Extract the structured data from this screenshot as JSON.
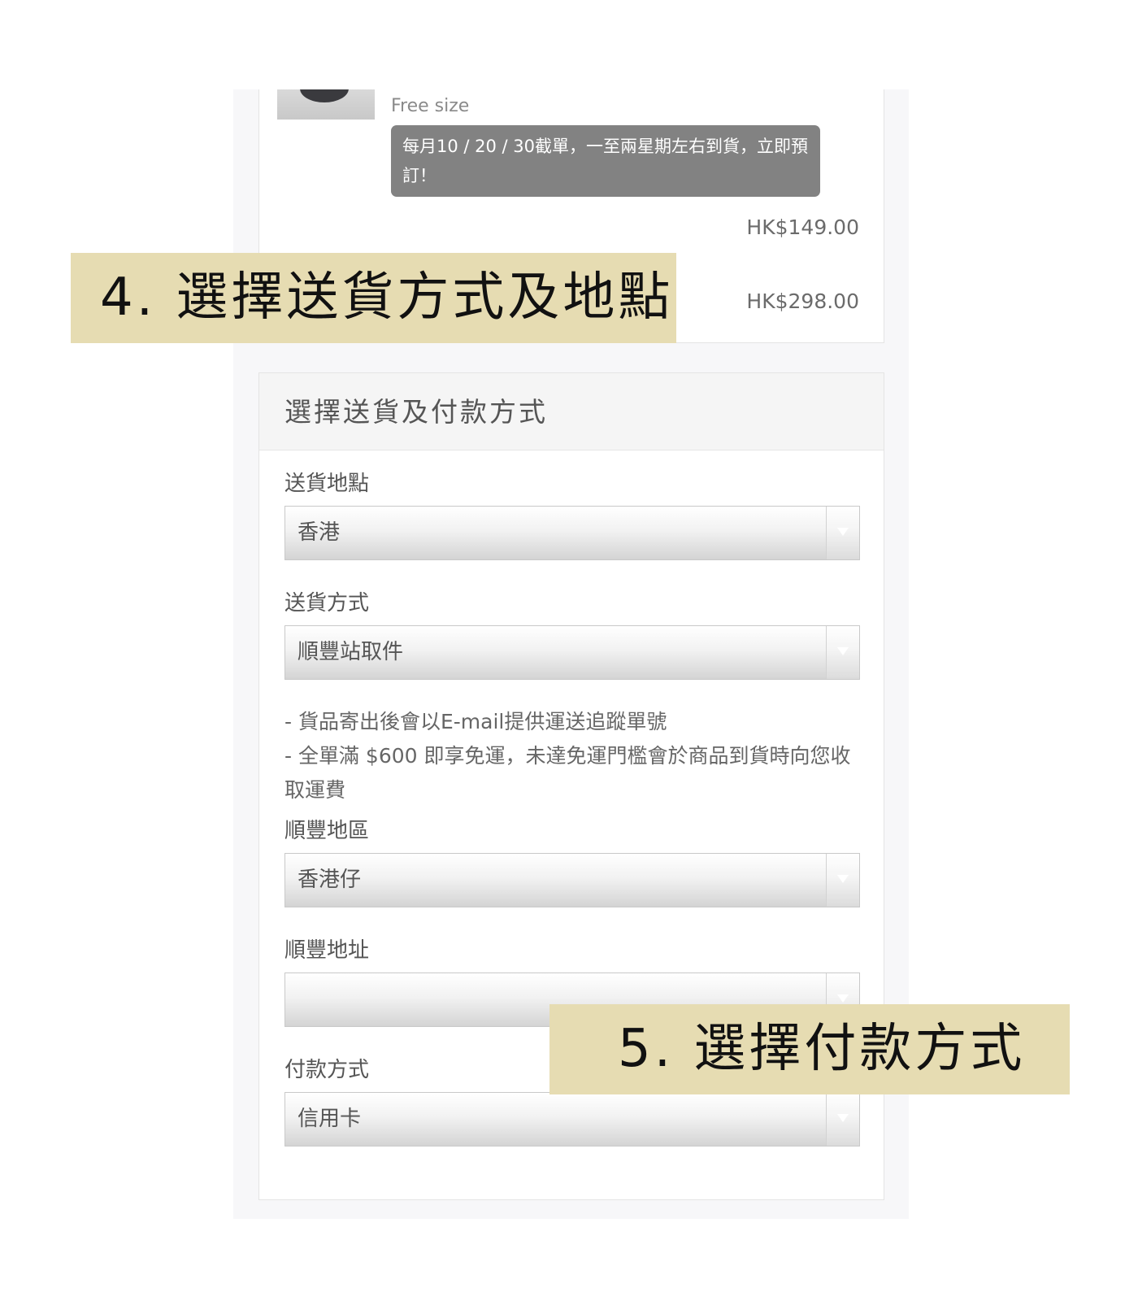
{
  "order": {
    "product_size": "Free size",
    "preorder_note": "每月10 / 20 / 30截單，一至兩星期左右到貨，立即預訂！",
    "item_price": "HK$149.00",
    "total_price": "HK$298.00"
  },
  "shipping": {
    "header": "選擇送貨及付款方式",
    "location_label": "送貨地點",
    "location_value": "香港",
    "method_label": "送貨方式",
    "method_value": "順豐站取件",
    "notes": [
      "- 貨品寄出後會以E-mail提供運送追蹤單號",
      "- 全單滿 $600 即享免運，未達免運門檻會於商品到貨時向您收取運費"
    ],
    "sf_region_label": "順豐地區",
    "sf_region_value": "香港仔",
    "sf_address_label": "順豐地址",
    "sf_address_value": "",
    "payment_label": "付款方式",
    "payment_value": "信用卡"
  },
  "callouts": {
    "step4": "4. 選擇送貨方式及地點",
    "step5": "5. 選擇付款方式"
  },
  "colors": {
    "callout_bg": "#e6dcb2",
    "note_bubble_bg": "#828282",
    "page_bg": "#f7f7f9"
  },
  "icons": {
    "select_arrow": "chevron-down-icon"
  }
}
